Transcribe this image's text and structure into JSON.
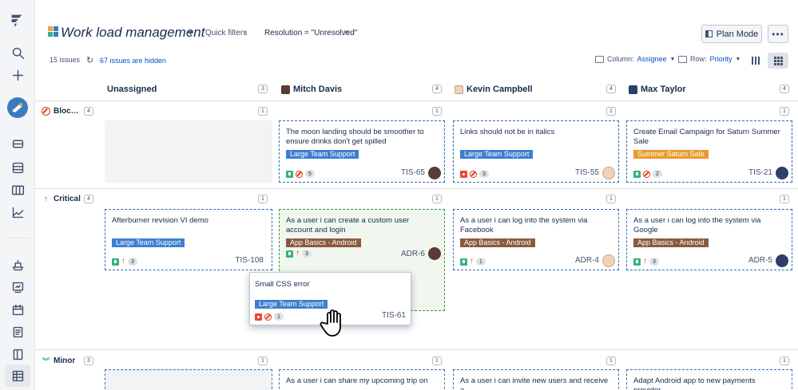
{
  "header": {
    "title": "Work load management",
    "quick_filters_label": "Quick filters",
    "active_filter": "Resolution = \"Unresolved\"",
    "plan_mode_label": "Plan Mode",
    "more_label": "•••"
  },
  "toolbar": {
    "issues_count": "15 issues",
    "hidden_link": "67 issues are hidden",
    "column_label": "Column:",
    "column_value": "Assignee",
    "row_label": "Row:",
    "row_value": "Priority"
  },
  "columns": [
    {
      "name": "Unassigned",
      "count": "3"
    },
    {
      "name": "Mitch Davis",
      "count": "4"
    },
    {
      "name": "Kevin Campbell",
      "count": "4"
    },
    {
      "name": "Max Taylor",
      "count": "4"
    }
  ],
  "rows": [
    {
      "name": "Bloc…",
      "count": "4",
      "icon": "blocker-icon",
      "cell_counts": [
        "1",
        "1",
        "1",
        "1"
      ]
    },
    {
      "name": "Critical",
      "count": "4",
      "icon": "critical-arrow-icon",
      "cell_counts": [
        "1",
        "1",
        "1",
        "1"
      ]
    },
    {
      "name": "Minor",
      "count": "3",
      "icon": "minor-chevrons-icon",
      "cell_counts": [
        "1",
        "1",
        "1",
        "1"
      ]
    }
  ],
  "cards": {
    "tis65": {
      "title": "The moon landing should be smoother to ensure drinks don't get spilled",
      "label": "Large Team Support",
      "estimate": "5",
      "key": "TIS-65"
    },
    "tis55": {
      "title": "Links should not be in italics",
      "label": "Large Team Support",
      "estimate": "3",
      "key": "TIS-55"
    },
    "tis21": {
      "title": "Create Email Campaign for Saturn Summer Sale",
      "label": "Summer Saturn Sale",
      "estimate": "2",
      "key": "TIS-21"
    },
    "tis108": {
      "title": "Afterburner revision VI demo",
      "label": "Large Team Support",
      "estimate": "3",
      "key": "TIS-108"
    },
    "adr6": {
      "title": "As a user i can create a custom user account and login",
      "label": "App Basics - Android",
      "estimate": "3",
      "key": "ADR-6"
    },
    "adr4": {
      "title": "As a user i can log into the system via Facebook",
      "label": "App Basics - Android",
      "estimate": "1",
      "key": "ADR-4"
    },
    "adr5": {
      "title": "As a user i can log into the system via Google",
      "label": "App Basics - Android",
      "estimate": "3",
      "key": "ADR-5"
    },
    "tis61": {
      "title": "Small CSS error",
      "label": "Large Team Support",
      "estimate": "1",
      "key": "TIS-61"
    },
    "minor_mitch": {
      "title": "As a user i can share my upcoming trip on"
    },
    "minor_kevin": {
      "title": "As a user i can invite new users and receive a"
    },
    "minor_max": {
      "title": "Adapt Android app to new payments provider"
    }
  },
  "colors": {
    "story": "#36b37e",
    "bug": "#e5493a",
    "blocker": "#de350b",
    "label_blue": "#3c7fd0",
    "label_brown": "#8b5a3c",
    "label_orange": "#e89b2c",
    "drop_zone": "#2e9e3a"
  }
}
